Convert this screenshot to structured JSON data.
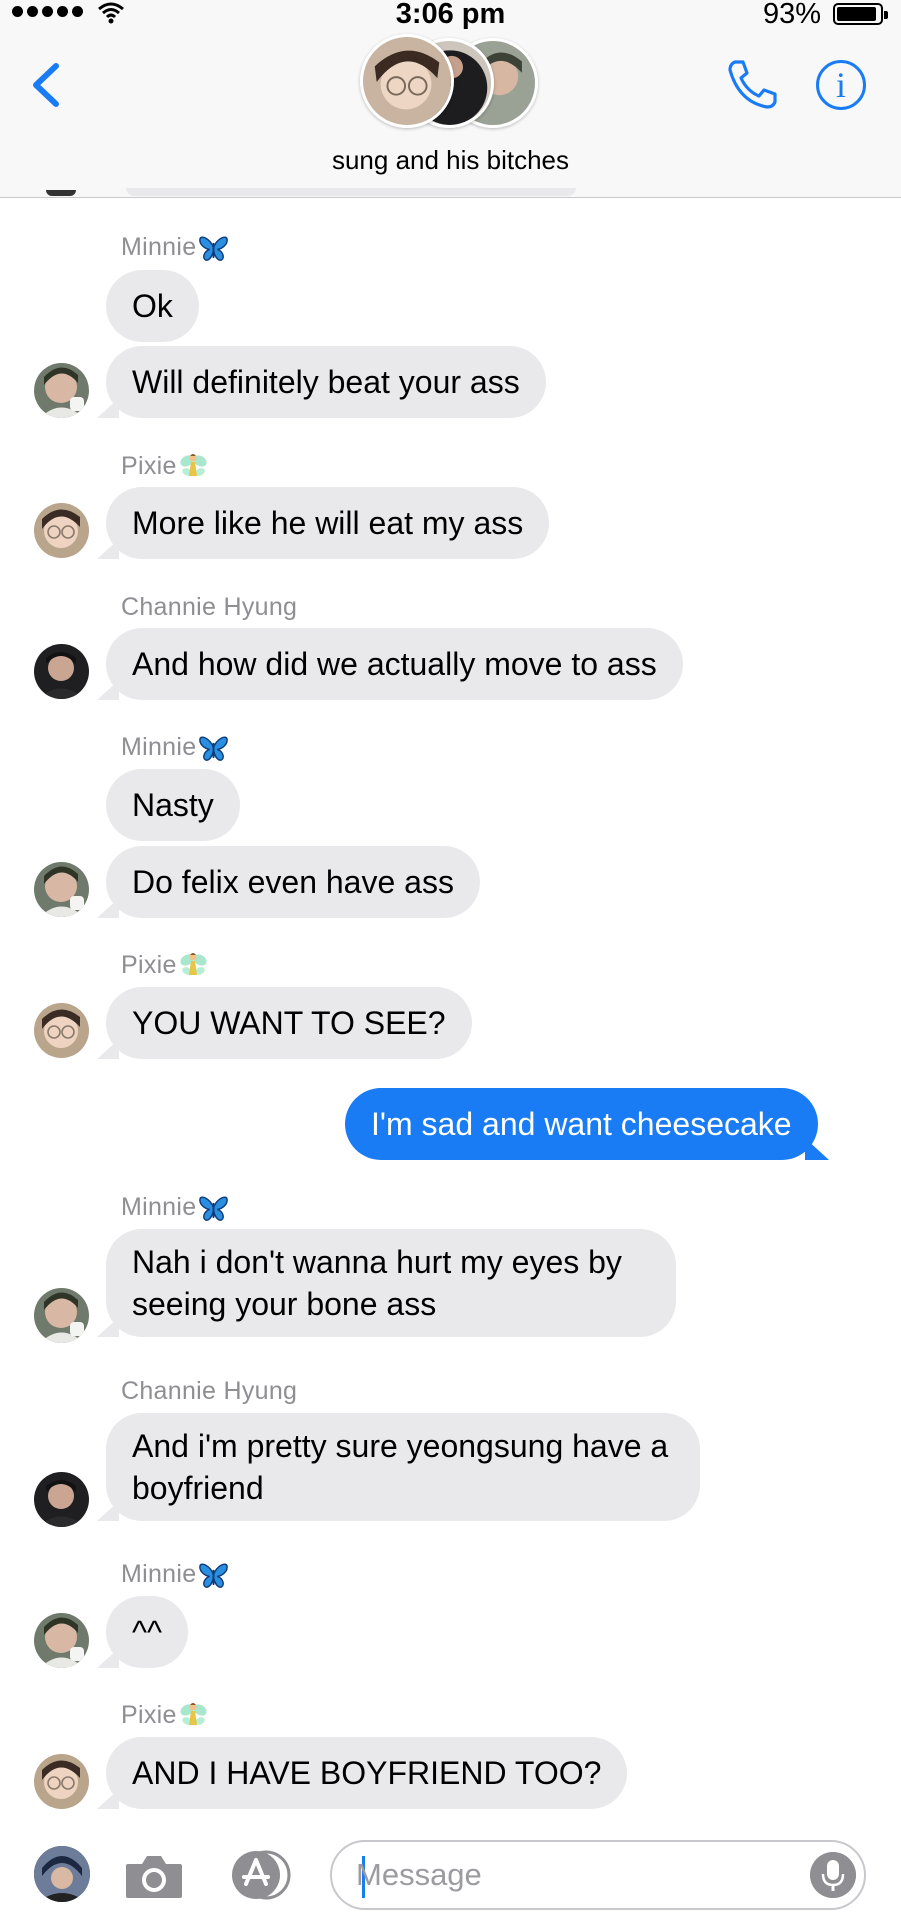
{
  "status_bar": {
    "time": "3:06 pm",
    "battery": "93%",
    "battery_level": 0.93,
    "signal_bars": 5
  },
  "header": {
    "group_name": "sung and his bitches",
    "back_icon": "chevron-left-icon",
    "call_icon": "phone-icon",
    "info_icon": "info-icon",
    "info_glyph": "i",
    "accent_color": "#1a7cf5"
  },
  "messages": [
    {
      "sender": "Minnie",
      "sender_emoji": "butterfly",
      "text": "Ok",
      "outgoing": false
    },
    {
      "sender": "",
      "text": "Will definitely beat your ass",
      "outgoing": false
    },
    {
      "sender": "Pixie",
      "sender_emoji": "fairy",
      "text": "More like he will eat my ass",
      "outgoing": false
    },
    {
      "sender": "Channie Hyung",
      "text": "And how did we actually move to ass",
      "outgoing": false
    },
    {
      "sender": "Minnie",
      "sender_emoji": "butterfly",
      "text": "Nasty",
      "outgoing": false
    },
    {
      "sender": "",
      "text": "Do felix even have ass",
      "outgoing": false
    },
    {
      "sender": "Pixie",
      "sender_emoji": "fairy",
      "text": "YOU WANT TO SEE?",
      "outgoing": false
    },
    {
      "sender": "",
      "text": "I'm sad and want cheesecake",
      "outgoing": true
    },
    {
      "sender": "Minnie",
      "sender_emoji": "butterfly",
      "text": "Nah i don't wanna hurt my eyes by seeing your bone ass",
      "outgoing": false
    },
    {
      "sender": "Channie Hyung",
      "text": "And i'm pretty sure yeongsung have a boyfriend",
      "outgoing": false
    },
    {
      "sender": "Minnie",
      "sender_emoji": "butterfly",
      "text": "^^",
      "outgoing": false
    },
    {
      "sender": "Pixie",
      "sender_emoji": "fairy",
      "text": "AND I HAVE BOYFRIEND TOO?",
      "outgoing": false
    }
  ],
  "input_bar": {
    "placeholder": "Message",
    "camera_icon": "camera-icon",
    "apps_icon": "app-store-icon",
    "mic_icon": "microphone-icon"
  },
  "colors": {
    "incoming_bubble": "#e9e9eb",
    "outgoing_bubble": "#1a7cf5",
    "sender_name": "#8e8e93"
  }
}
